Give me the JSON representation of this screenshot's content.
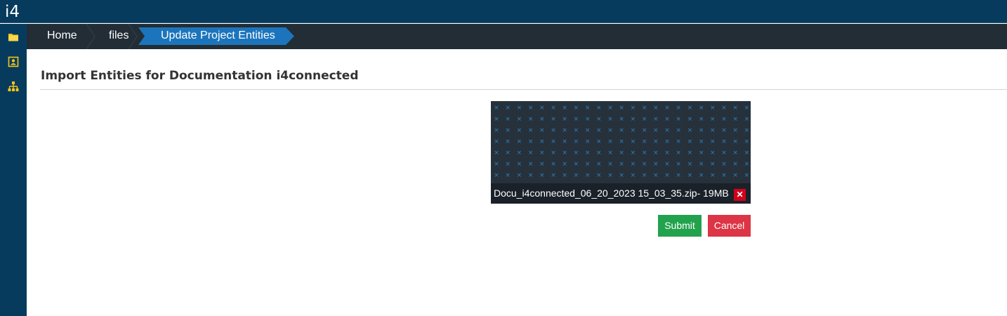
{
  "app": {
    "logo": "i4"
  },
  "sidebar": {
    "items": [
      {
        "icon": "folder-icon"
      },
      {
        "icon": "contact-card-icon"
      },
      {
        "icon": "sitemap-icon"
      }
    ]
  },
  "breadcrumb": {
    "items": [
      "Home",
      "files",
      "Update Project Entities"
    ]
  },
  "page": {
    "title": "Import Entities for Documentation i4connected"
  },
  "upload": {
    "file_label": "Docu_i4connected_06_20_2023 15_03_35.zip- 19MB",
    "remove_glyph": "✕"
  },
  "actions": {
    "submit_label": "Submit",
    "cancel_label": "Cancel"
  },
  "colors": {
    "header": "#073b5e",
    "breadcrumb_bar": "#222d35",
    "breadcrumb_active": "#1c75bc",
    "submit": "#22a24d",
    "cancel": "#dc3545",
    "remove": "#d0021b"
  }
}
